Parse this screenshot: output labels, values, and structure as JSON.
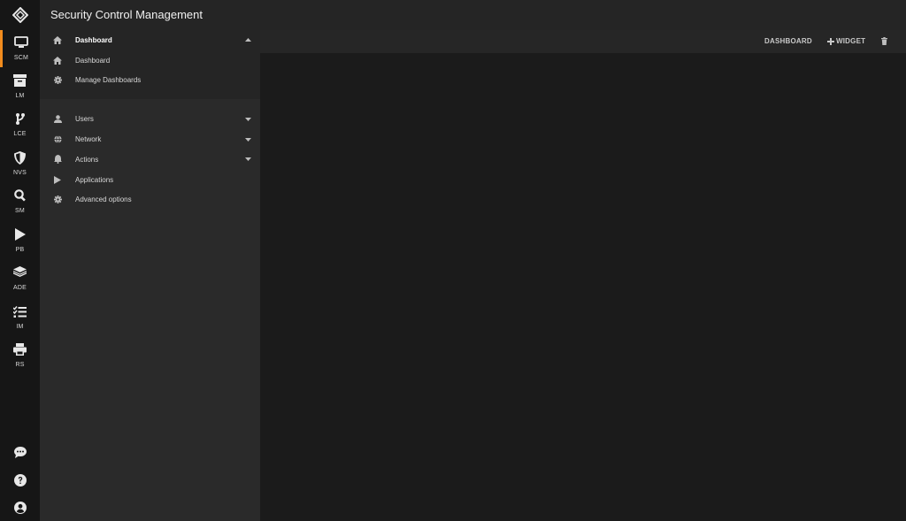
{
  "app": {
    "title": "Security Control Management"
  },
  "rail": {
    "items": [
      {
        "label": "SCM",
        "icon": "monitor-icon",
        "active": true
      },
      {
        "label": "LM",
        "icon": "archive-box-icon",
        "active": false
      },
      {
        "label": "LCE",
        "icon": "branch-icon",
        "active": false
      },
      {
        "label": "NVS",
        "icon": "shield-icon",
        "active": false
      },
      {
        "label": "SM",
        "icon": "search-icon",
        "active": false
      },
      {
        "label": "PB",
        "icon": "play-icon",
        "active": false
      },
      {
        "label": "ADE",
        "icon": "layers-icon",
        "active": false
      },
      {
        "label": "IM",
        "icon": "checklist-icon",
        "active": false
      },
      {
        "label": "RS",
        "icon": "printer-icon",
        "active": false
      }
    ],
    "bottom": [
      {
        "icon": "chat-icon"
      },
      {
        "icon": "help-icon"
      },
      {
        "icon": "user-account-icon"
      }
    ],
    "accent_color": "#f28c1e"
  },
  "sidebar": {
    "dashboard_group": {
      "header": "Dashboard",
      "items": [
        "Dashboard",
        "Manage Dashboards"
      ]
    },
    "items": [
      {
        "label": "Users",
        "icon": "user-icon",
        "expandable": true
      },
      {
        "label": "Network",
        "icon": "globe-icon",
        "expandable": true
      },
      {
        "label": "Actions",
        "icon": "bell-icon",
        "expandable": true
      },
      {
        "label": "Applications",
        "icon": "play-icon",
        "expandable": false
      },
      {
        "label": "Advanced options",
        "icon": "gear-icon",
        "expandable": false
      }
    ]
  },
  "toolbar": {
    "dashboard_label": "DASHBOARD",
    "widget_label": "WIDGET",
    "delete_icon": "trash-icon"
  }
}
